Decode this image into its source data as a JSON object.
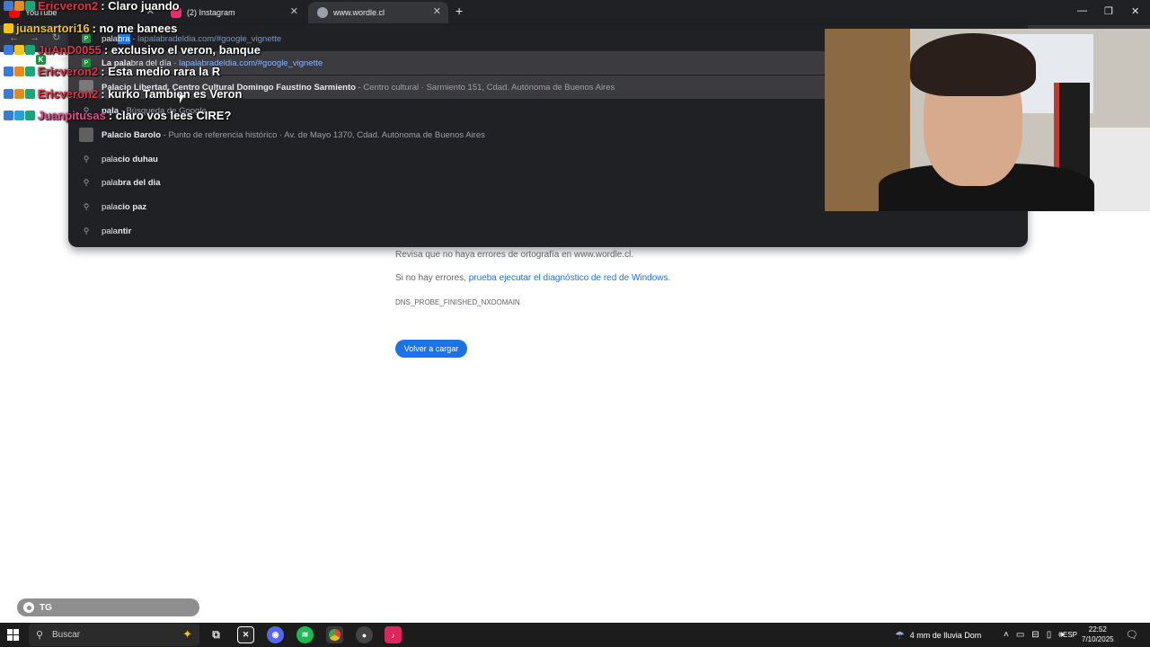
{
  "tabs": [
    {
      "label": "YouTube",
      "color": "#ff0000",
      "active": false
    },
    {
      "label": "(2) Instagram",
      "color": "#e1306c",
      "active": false
    },
    {
      "label": "www.wordle.cl",
      "color": "#9aa0a6",
      "active": true
    }
  ],
  "window": {
    "minimize": "—",
    "restore": "❐",
    "close": "✕",
    "new_tab": "+"
  },
  "toolbar": {
    "back_label": "Volver"
  },
  "omnibox": {
    "input_typed": "pala",
    "input_autocomplete": "bra",
    "input_url": "lapalabradeldia.com/#google_vignette",
    "suggestions": [
      {
        "bold": "La pala",
        "rest": "bra del día",
        "sep": " - ",
        "url": "lapalabradeldia.com/#google_vignette",
        "icon": "P"
      },
      {
        "bold": "Pala",
        "rest": "cio Libertad, Centro Cultural Domingo Faustino Sarmiento",
        "sep": " - ",
        "dim": "Centro cultural · Sarmiento 151, Cdad. Autónoma de Buenos Aires",
        "icon": "building"
      },
      {
        "bold": "pala",
        "rest": "",
        "sep": " - ",
        "dim": "Búsqueda de Google",
        "icon": "search"
      },
      {
        "bold": "Pala",
        "rest": "cio Barolo",
        "sep": " - ",
        "dim": "Punto de referencia histórico · Av. de Mayo 1370, Cdad. Autónoma de Buenos Aires",
        "icon": "building"
      },
      {
        "bold": "pala",
        "rest": "cio duhau",
        "icon": "search"
      },
      {
        "bold": "pala",
        "rest": "bra del dia",
        "icon": "search"
      },
      {
        "bold": "pala",
        "rest": "cio paz",
        "icon": "search"
      },
      {
        "bold": "pala",
        "rest": "ntir",
        "icon": "search"
      }
    ]
  },
  "chat": [
    {
      "user": "Ericveron2",
      "color": "#e0324b",
      "msg": ": Claro juando"
    },
    {
      "user": "juansartori16",
      "color": "#f5c518",
      "msg": ": no me banees"
    },
    {
      "user": "JuAnD0055",
      "color": "#e0324b",
      "msg": ": exclusivo el veron, banque"
    },
    {
      "user": "Ericveron2",
      "color": "#e0324b",
      "msg": ": Esta medio rara la R"
    },
    {
      "user": "Ericveron2",
      "color": "#e0324b",
      "msg": ": kurko Tambien es Veron"
    },
    {
      "user": "Juanpitusas",
      "color": "#e34b8f",
      "msg": ": claro vos lees CIRE?"
    }
  ],
  "error": {
    "line1": "Revisa que no haya errores de ortografía en www.wordle.cl.",
    "line2_prefix": "Si no hay errores, ",
    "line2_link": "prueba ejecutar el diagnóstico de red de Windows",
    "line2_suffix": ".",
    "code": "DNS_PROBE_FINISHED_NXDOMAIN",
    "reload_button": "Volver a cargar"
  },
  "overlay_tag": "TG",
  "taskbar": {
    "search_placeholder": "Buscar",
    "weather": "4 mm de lluvia Dom",
    "lang": "ESP",
    "time": "22:52",
    "date": "7/10/2025"
  }
}
